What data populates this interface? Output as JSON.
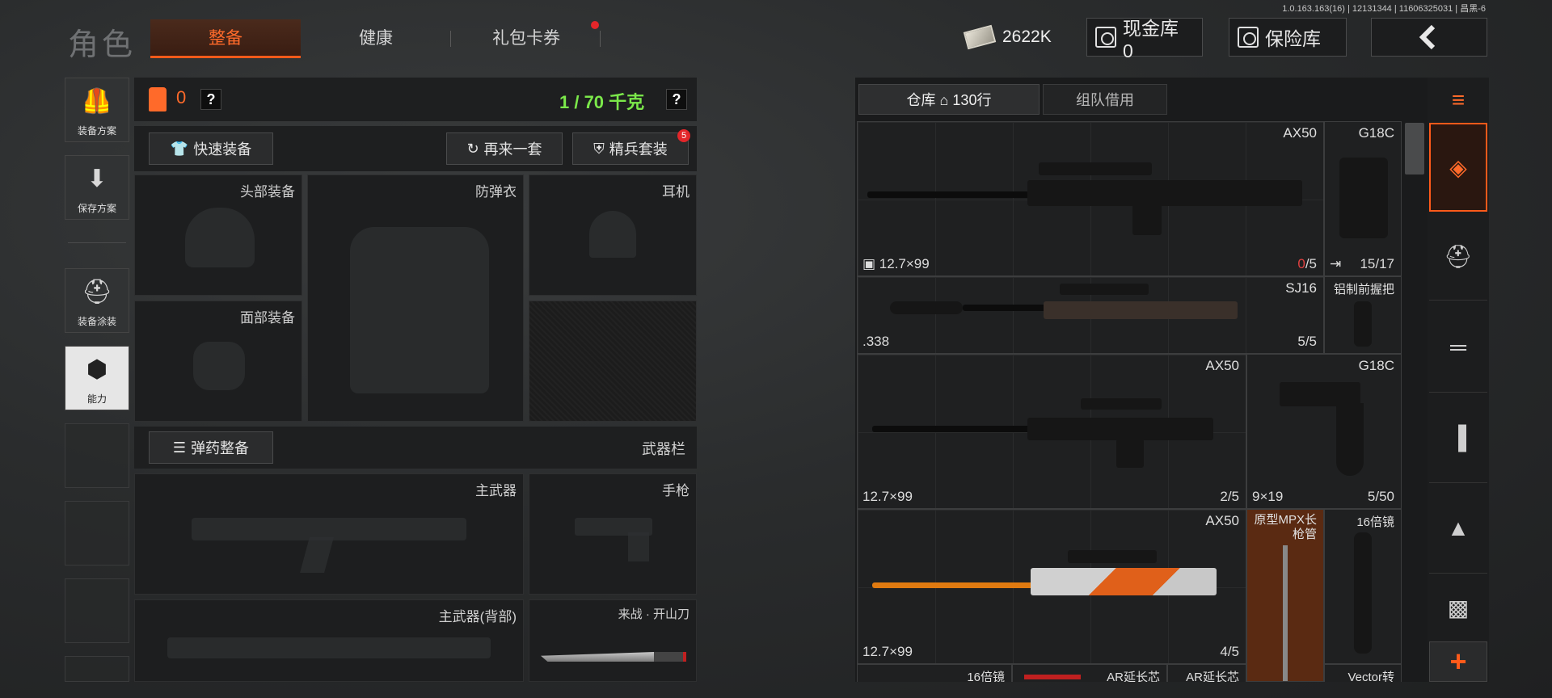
{
  "version": "1.0.163.163(16) | 12131344 | 11606325031 | 昌黑-6",
  "header": {
    "title": "角色",
    "tabs": [
      {
        "label": "整备",
        "active": true
      },
      {
        "label": "健康",
        "active": false
      },
      {
        "label": "礼包卡券",
        "active": false,
        "notification": true
      }
    ],
    "money_value": "2622K",
    "cash_vault_label": "现金库 0",
    "insurance_label": "保险库",
    "back_icon": "chevron-left-icon"
  },
  "sidebar": {
    "items": [
      {
        "label": "装备方案",
        "icon": "vest-icon"
      },
      {
        "label": "保存方案",
        "icon": "download-icon"
      },
      {
        "label": "装备涂装",
        "icon": "helmet-skin-icon"
      },
      {
        "label": "能力",
        "icon": "ability-icon",
        "active": true
      }
    ]
  },
  "loadout": {
    "armor_count": "0",
    "weight": "1 / 70 千克",
    "help": "?",
    "quick_equip": "快速装备",
    "again_set": "再来一套",
    "elite_set": "精兵套装",
    "elite_badge": "5",
    "slots": {
      "head": "头部装备",
      "vest": "防弹衣",
      "headset": "耳机",
      "face": "面部装备",
      "ammo_prep": "弹药整备",
      "weapon_bar": "武器栏",
      "primary": "主武器",
      "pistol": "手枪",
      "primary_back": "主武器(背部)",
      "melee": "来战 · 开山刀"
    }
  },
  "warehouse": {
    "tabs": [
      {
        "label": "仓库",
        "rows": "130行",
        "active": true
      },
      {
        "label": "组队借用",
        "active": false
      }
    ],
    "items": [
      {
        "name": "AX50",
        "ammo": "12.7×99",
        "count_zero": "0",
        "count_rest": "/5"
      },
      {
        "name": "G18C",
        "ammo": "",
        "count": "15/17"
      },
      {
        "name": "SJ16",
        "ammo": ".338",
        "count": "5/5"
      },
      {
        "name": "铝制前握把"
      },
      {
        "name": "AX50",
        "ammo": "12.7×99",
        "count": "2/5"
      },
      {
        "name": "G18C",
        "ammo": "9×19",
        "count": "5/50"
      },
      {
        "name": "AX50",
        "ammo": "12.7×99",
        "count": "4/5"
      },
      {
        "name": "原型MPX长枪管"
      },
      {
        "name": "16倍镜"
      },
      {
        "name": "16倍镜"
      },
      {
        "name": "AR延长芯"
      },
      {
        "name": "AR延长芯"
      },
      {
        "name": "Vector转"
      }
    ]
  },
  "categories": [
    "stack-icon",
    "layers-icon",
    "helmet-icon",
    "rifle-icon",
    "magazine-icon",
    "bullet-icon",
    "sight-icon",
    "plus-icon"
  ],
  "colors": {
    "accent": "#ff5a1a",
    "weight_green": "#7be84a",
    "warn_red": "#e04040"
  }
}
